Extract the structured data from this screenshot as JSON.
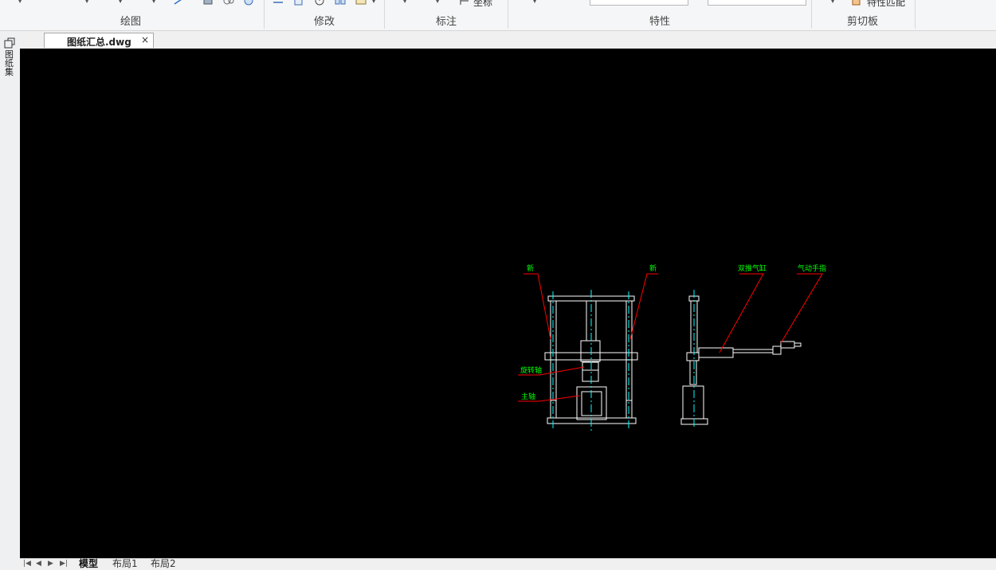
{
  "ribbon": {
    "groups": [
      {
        "label": "绘图"
      },
      {
        "label": "修改"
      },
      {
        "label": "标注"
      },
      {
        "label": "特性"
      },
      {
        "label": "剪切板"
      }
    ],
    "coordinate_label": "坐标",
    "match_properties_label": "特性匹配"
  },
  "left_strip": {
    "label": "图纸集"
  },
  "document": {
    "tab_title": "图纸汇总.dwg",
    "close_glyph": "×"
  },
  "drawing": {
    "annotations": [
      "新",
      "新",
      "双推气缸",
      "气动手指",
      "旋转轴",
      "主轴"
    ],
    "line_color": "#ffffff",
    "centerline_color": "#00ffff",
    "leader_color": "#ff0000",
    "text_color": "#00ff00"
  },
  "layout_tabs": [
    {
      "label": "模型"
    },
    {
      "label": "布局1"
    },
    {
      "label": "布局2"
    }
  ],
  "nav_glyphs": [
    "|◀",
    "◀",
    "▶",
    "▶|"
  ]
}
